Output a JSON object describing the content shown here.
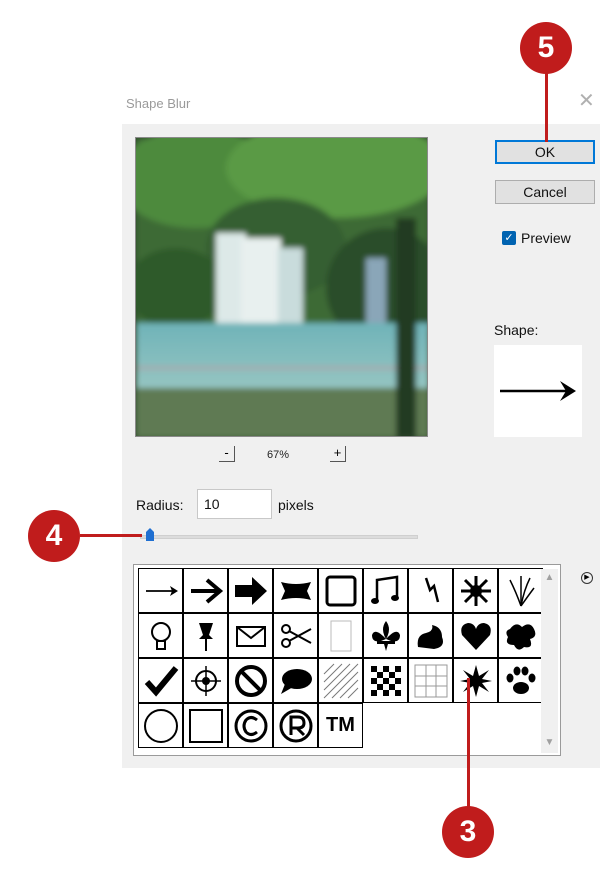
{
  "dialog": {
    "title": "Shape Blur",
    "close_icon": "close-icon"
  },
  "buttons": {
    "ok": "OK",
    "cancel": "Cancel"
  },
  "preview": {
    "checkbox_label": "Preview",
    "checked": true,
    "zoom_out": "-",
    "zoom_in": "+",
    "zoom_level": "67%"
  },
  "shape": {
    "label": "Shape:",
    "selected_icon": "arrow-right-icon"
  },
  "radius": {
    "label": "Radius:",
    "value": "10",
    "unit": "pixels",
    "slider_fraction": 0.02
  },
  "shape_grid": {
    "cells": [
      {
        "name": "thin-arrow-icon"
      },
      {
        "name": "arrow-icon"
      },
      {
        "name": "bold-arrow-icon"
      },
      {
        "name": "banner-icon"
      },
      {
        "name": "frame-icon"
      },
      {
        "name": "music-note-icon"
      },
      {
        "name": "lightning-icon"
      },
      {
        "name": "starburst-icon"
      },
      {
        "name": "grass-icon"
      },
      {
        "name": "light-bulb-icon"
      },
      {
        "name": "pushpin-icon"
      },
      {
        "name": "envelope-icon"
      },
      {
        "name": "scissors-icon"
      },
      {
        "name": "blank-page-icon"
      },
      {
        "name": "fleur-de-lis-icon"
      },
      {
        "name": "ornament-icon"
      },
      {
        "name": "heart-icon"
      },
      {
        "name": "splat-icon"
      },
      {
        "name": "checkmark-icon"
      },
      {
        "name": "target-icon"
      },
      {
        "name": "no-sign-icon"
      },
      {
        "name": "speech-bubble-icon"
      },
      {
        "name": "hatch-pattern-icon"
      },
      {
        "name": "checkerboard-icon"
      },
      {
        "name": "grid-icon"
      },
      {
        "name": "star-burst-icon"
      },
      {
        "name": "paw-print-icon"
      },
      {
        "name": "circle-icon"
      },
      {
        "name": "square-icon"
      },
      {
        "name": "copyright-icon"
      },
      {
        "name": "registered-icon"
      },
      {
        "name": "trademark-icon",
        "text": "TM"
      }
    ]
  },
  "callouts": {
    "ok_step": "5",
    "slider_step": "4",
    "grid_step": "3",
    "color": "#c01c1c"
  }
}
